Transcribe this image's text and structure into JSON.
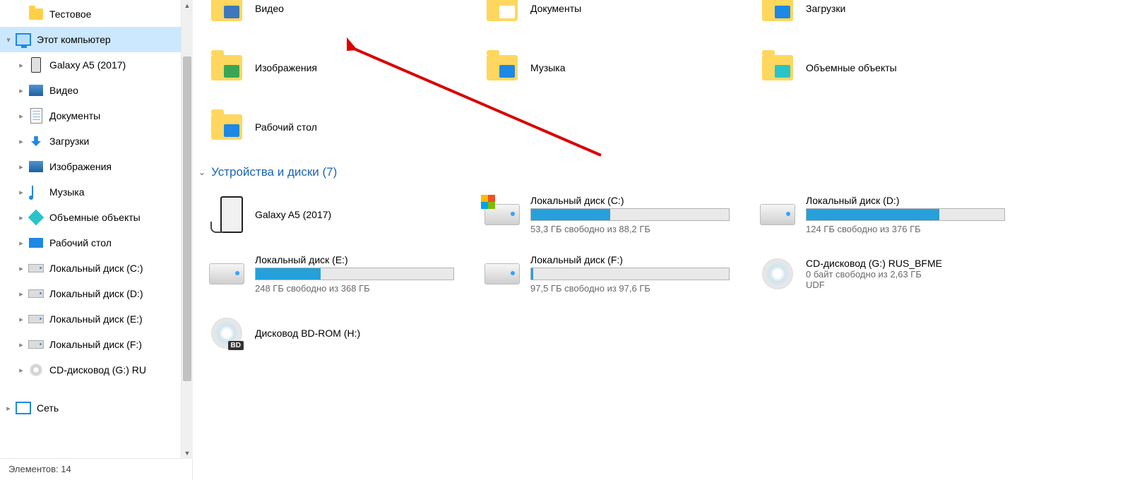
{
  "sidebar": {
    "items": [
      {
        "label": "Тестовое",
        "icon": "folder",
        "depth": 2,
        "chev": ""
      },
      {
        "label": "Этот компьютер",
        "icon": "monitor",
        "depth": 1,
        "chev": "▾",
        "selected": true
      },
      {
        "label": "Galaxy A5 (2017)",
        "icon": "phone",
        "depth": 2,
        "chev": "▸"
      },
      {
        "label": "Видео",
        "icon": "video",
        "depth": 2,
        "chev": "▸"
      },
      {
        "label": "Документы",
        "icon": "doc",
        "depth": 2,
        "chev": "▸"
      },
      {
        "label": "Загрузки",
        "icon": "down",
        "depth": 2,
        "chev": "▸"
      },
      {
        "label": "Изображения",
        "icon": "image",
        "depth": 2,
        "chev": "▸"
      },
      {
        "label": "Музыка",
        "icon": "music",
        "depth": 2,
        "chev": "▸"
      },
      {
        "label": "Объемные объекты",
        "icon": "box",
        "depth": 2,
        "chev": "▸"
      },
      {
        "label": "Рабочий стол",
        "icon": "desk",
        "depth": 2,
        "chev": "▸"
      },
      {
        "label": "Локальный диск (C:)",
        "icon": "drive",
        "depth": 2,
        "chev": "▸"
      },
      {
        "label": "Локальный диск (D:)",
        "icon": "drive",
        "depth": 2,
        "chev": "▸"
      },
      {
        "label": "Локальный диск (E:)",
        "icon": "drive",
        "depth": 2,
        "chev": "▸"
      },
      {
        "label": "Локальный диск (F:)",
        "icon": "drive",
        "depth": 2,
        "chev": "▸"
      },
      {
        "label": "CD-дисковод (G:) RU",
        "icon": "disc",
        "depth": 2,
        "chev": "▸"
      },
      {
        "label": "",
        "icon": "",
        "depth": 0,
        "chev": "",
        "spacer": true
      },
      {
        "label": "Сеть",
        "icon": "net",
        "depth": 1,
        "chev": "▸"
      }
    ]
  },
  "status": {
    "text": "Элементов: 14"
  },
  "folders_top": [
    {
      "label": "Видео",
      "accent": "#3e77bb"
    },
    {
      "label": "Документы",
      "accent": "#ffffff"
    },
    {
      "label": "Загрузки",
      "accent": "#1e88e5"
    }
  ],
  "folders_mid": [
    {
      "label": "Изображения",
      "accent": "#3aa655"
    },
    {
      "label": "Музыка",
      "accent": "#1e88e5"
    },
    {
      "label": "Объемные объекты",
      "accent": "#2ac3c9"
    }
  ],
  "folders_low": [
    {
      "label": "Рабочий стол",
      "accent": "#1e88e5"
    }
  ],
  "devices_header": "Устройства и диски (7)",
  "devices": [
    {
      "slot": "a0",
      "title": "Galaxy A5 (2017)",
      "kind": "phone",
      "pct": 0,
      "sub": ""
    },
    {
      "slot": "a1",
      "title": "Локальный диск (C:)",
      "kind": "drive-win",
      "pct": 40,
      "sub": "53,3 ГБ свободно из 88,2 ГБ"
    },
    {
      "slot": "a2",
      "title": "Локальный диск (D:)",
      "kind": "drive",
      "pct": 67,
      "sub": "124 ГБ свободно из 376 ГБ"
    },
    {
      "slot": "b0",
      "title": "Локальный диск (E:)",
      "kind": "drive",
      "pct": 33,
      "sub": "248 ГБ свободно из 368 ГБ"
    },
    {
      "slot": "b1",
      "title": "Локальный диск (F:)",
      "kind": "drive",
      "pct": 1,
      "sub": "97,5 ГБ свободно из 97,6 ГБ"
    },
    {
      "slot": "b2",
      "title": "CD-дисковод (G:) RUS_BFME",
      "kind": "disc",
      "pct": -1,
      "sub": "0 байт свободно из 2,63 ГБ",
      "sub2": "UDF"
    },
    {
      "slot": "c0",
      "title": "Дисковод BD-ROM (H:)",
      "kind": "disc-bd",
      "pct": -1,
      "sub": ""
    }
  ]
}
